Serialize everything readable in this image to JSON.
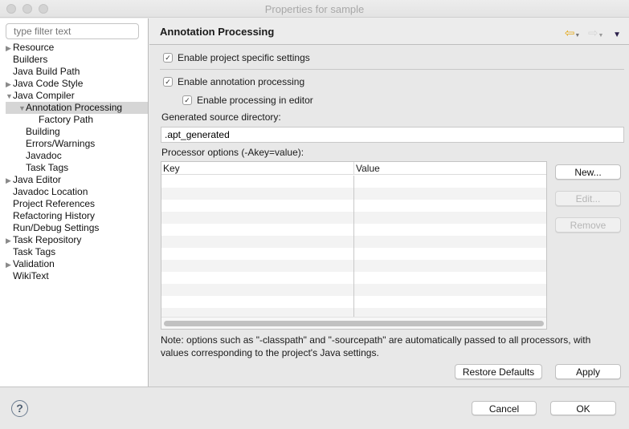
{
  "window": {
    "title": "Properties for sample"
  },
  "sidebar": {
    "filter_placeholder": "type filter text",
    "items": [
      {
        "label": "Resource",
        "level": 0,
        "twisty": "collapsed"
      },
      {
        "label": "Builders",
        "level": 0,
        "twisty": "none"
      },
      {
        "label": "Java Build Path",
        "level": 0,
        "twisty": "none"
      },
      {
        "label": "Java Code Style",
        "level": 0,
        "twisty": "collapsed"
      },
      {
        "label": "Java Compiler",
        "level": 0,
        "twisty": "expanded"
      },
      {
        "label": "Annotation Processing",
        "level": 1,
        "twisty": "expanded",
        "selected": true
      },
      {
        "label": "Factory Path",
        "level": 2,
        "twisty": "none"
      },
      {
        "label": "Building",
        "level": 1,
        "twisty": "none"
      },
      {
        "label": "Errors/Warnings",
        "level": 1,
        "twisty": "none"
      },
      {
        "label": "Javadoc",
        "level": 1,
        "twisty": "none"
      },
      {
        "label": "Task Tags",
        "level": 1,
        "twisty": "none"
      },
      {
        "label": "Java Editor",
        "level": 0,
        "twisty": "collapsed"
      },
      {
        "label": "Javadoc Location",
        "level": 0,
        "twisty": "none"
      },
      {
        "label": "Project References",
        "level": 0,
        "twisty": "none"
      },
      {
        "label": "Refactoring History",
        "level": 0,
        "twisty": "none"
      },
      {
        "label": "Run/Debug Settings",
        "level": 0,
        "twisty": "none"
      },
      {
        "label": "Task Repository",
        "level": 0,
        "twisty": "collapsed"
      },
      {
        "label": "Task Tags",
        "level": 0,
        "twisty": "none"
      },
      {
        "label": "Validation",
        "level": 0,
        "twisty": "collapsed"
      },
      {
        "label": "WikiText",
        "level": 0,
        "twisty": "none"
      }
    ]
  },
  "page": {
    "title": "Annotation Processing",
    "nav": {
      "back_icon": "back-arrow-icon",
      "forward_icon": "forward-arrow-icon",
      "menu_icon": "view-menu-icon"
    },
    "enable_project_specific": {
      "label": "Enable project specific settings",
      "checked": true
    },
    "enable_annotation_processing": {
      "label": "Enable annotation processing",
      "checked": true
    },
    "enable_processing_in_editor": {
      "label": "Enable processing in editor",
      "checked": true
    },
    "generated_source_label": "Generated source directory:",
    "generated_source_value": ".apt_generated",
    "processor_options_label": "Processor options (-Akey=value):",
    "table": {
      "columns": [
        "Key",
        "Value"
      ],
      "rows": []
    },
    "buttons": {
      "new": "New...",
      "edit": "Edit...",
      "remove": "Remove",
      "restore_defaults": "Restore Defaults",
      "apply": "Apply"
    },
    "note": "Note: options such as \"-classpath\" and \"-sourcepath\" are automatically passed to all processors, with values corresponding to the project's Java settings."
  },
  "footer": {
    "help_icon": "help-icon",
    "cancel": "Cancel",
    "ok": "OK"
  }
}
